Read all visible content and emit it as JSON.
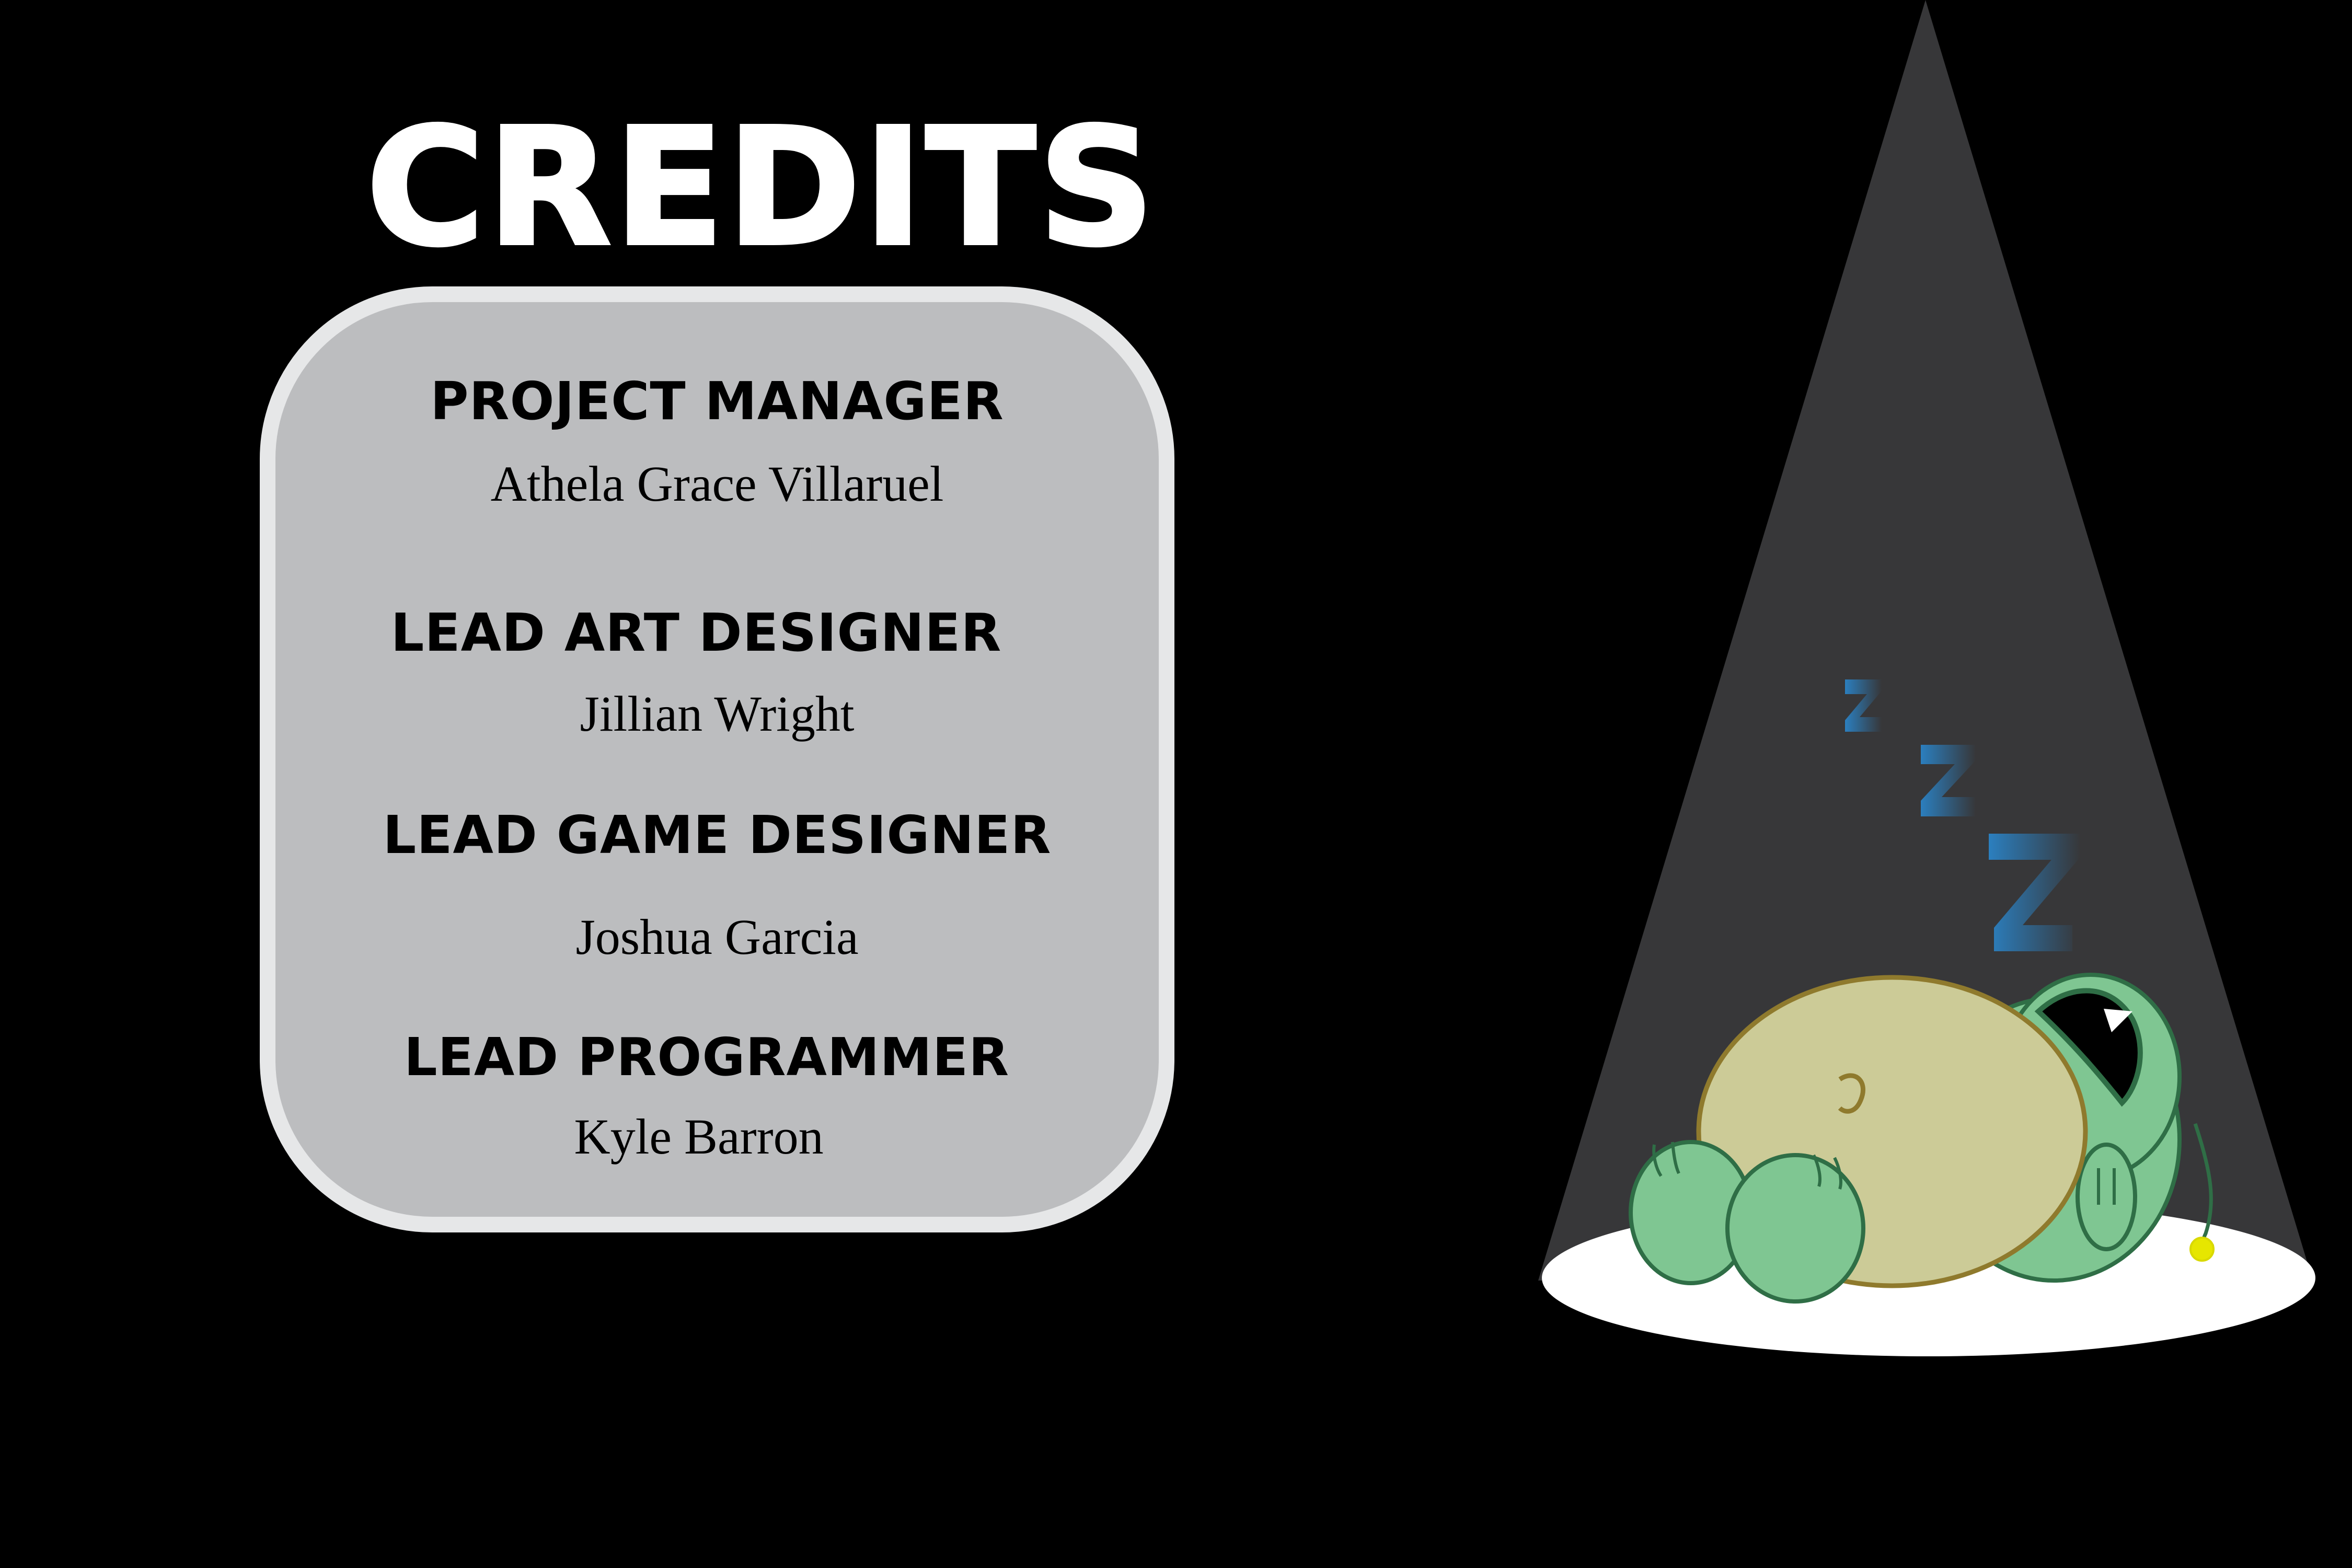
{
  "screen": {
    "title": "Credits",
    "credits": [
      {
        "role": "Project Manager",
        "name": "Athela Grace Villaruel"
      },
      {
        "role": "Lead Art Designer",
        "name": "Jillian Wright"
      },
      {
        "role": "Lead Game Designer",
        "name": "Joshua Garcia"
      },
      {
        "role": "Lead Programmer",
        "name": "Kyle Barron"
      }
    ]
  },
  "colors": {
    "background": "#000000",
    "panel": "#bcbdbf",
    "panel_border": "#e6e7e8",
    "spotlight": "#373739",
    "turtle_skin": "#7fc692",
    "turtle_outline": "#2f6e46",
    "shell": "#cccb97",
    "shell_outline": "#8f7a2d",
    "zzz": "#2b7fbf"
  },
  "icons": {
    "turtle": "sleeping-turtle-illustration",
    "sleep": "zzz-icon"
  }
}
